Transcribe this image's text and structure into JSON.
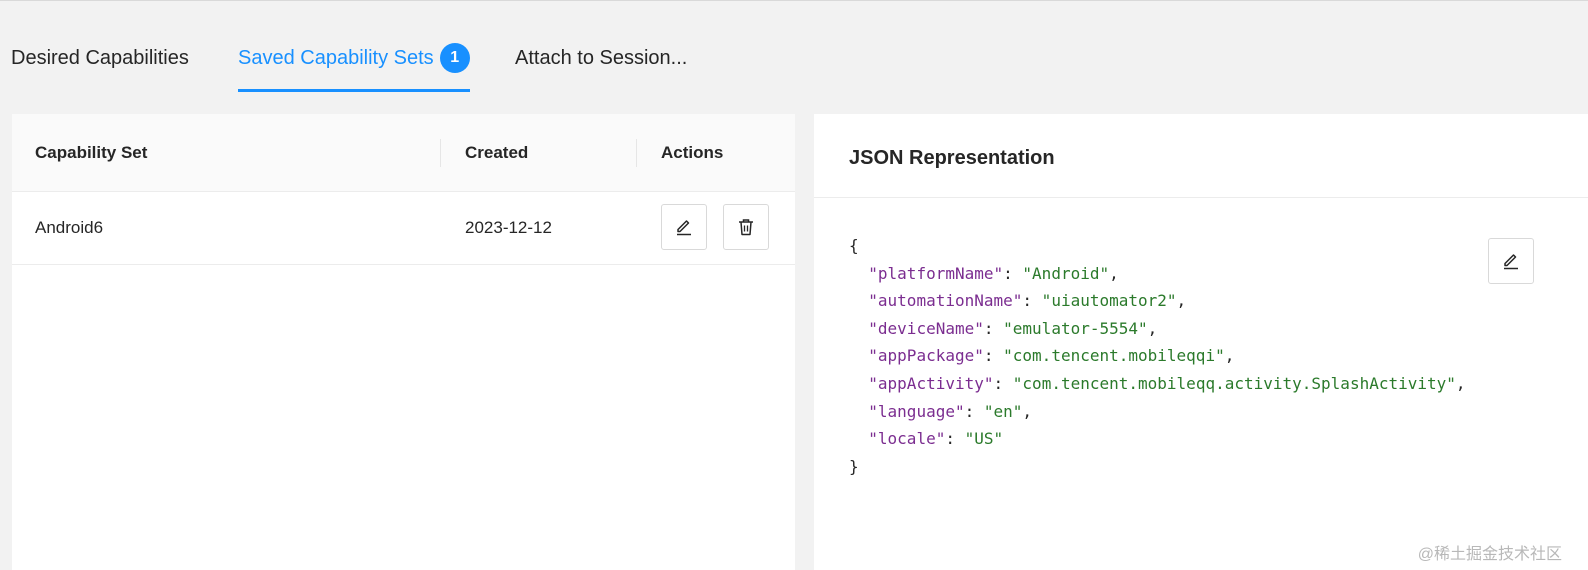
{
  "tabs": [
    {
      "label": "Desired Capabilities",
      "active": false
    },
    {
      "label": "Saved Capability Sets",
      "active": true,
      "badge": "1"
    },
    {
      "label": "Attach to Session..."
    }
  ],
  "table": {
    "headers": [
      "Capability Set",
      "Created",
      "Actions"
    ],
    "rows": [
      {
        "name": "Android6",
        "created": "2023-12-12"
      }
    ],
    "actions": {
      "edit_icon": "edit-icon",
      "delete_icon": "trash-icon"
    }
  },
  "json_panel": {
    "title": "JSON Representation",
    "edit_icon": "edit-icon",
    "open_brace": "{",
    "close_brace": "}",
    "entries": [
      {
        "key": "platformName",
        "value": "Android"
      },
      {
        "key": "automationName",
        "value": "uiautomator2"
      },
      {
        "key": "deviceName",
        "value": "emulator-5554"
      },
      {
        "key": "appPackage",
        "value": "com.tencent.mobileqqi"
      },
      {
        "key": "appActivity",
        "value": "com.tencent.mobileqq.activity.SplashActivity"
      },
      {
        "key": "language",
        "value": "en"
      },
      {
        "key": "locale",
        "value": "US"
      }
    ]
  },
  "watermark": "@稀土掘金技术社区",
  "colors": {
    "accent": "#1890ff",
    "json_key": "#7b2d90",
    "json_value": "#2b7a2b"
  }
}
